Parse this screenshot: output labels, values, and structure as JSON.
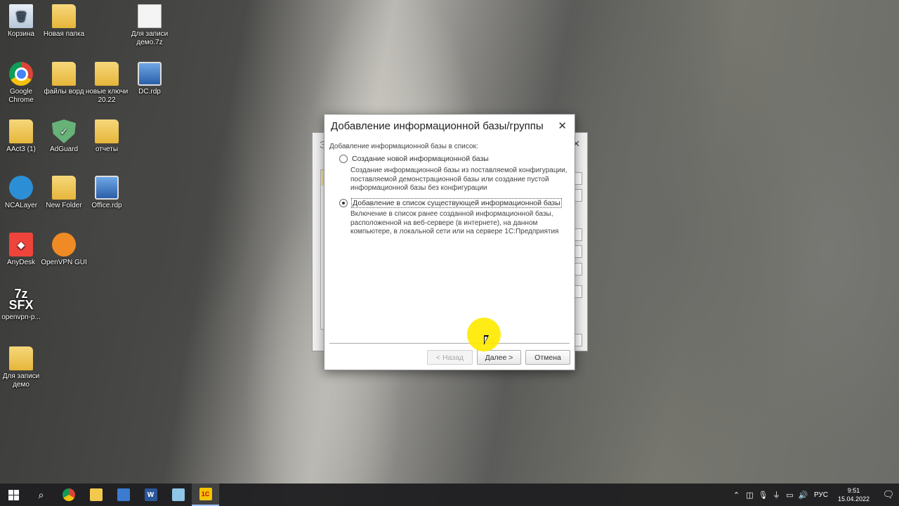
{
  "desktop": {
    "icons": [
      {
        "label": "Корзина",
        "icon": "recycle-bin-icon"
      },
      {
        "label": "Новая папка",
        "icon": "folder-icon"
      },
      {
        "label": "Для записи демо.7z",
        "icon": "file-icon"
      },
      {
        "label": "Google Chrome",
        "icon": "chrome-icon"
      },
      {
        "label": "файлы ворд",
        "icon": "folder-icon"
      },
      {
        "label": "новые ключи 20.22",
        "icon": "folder-icon"
      },
      {
        "label": "DC.rdp",
        "icon": "rdp-icon"
      },
      {
        "label": "AAct3 (1)",
        "icon": "folder-icon"
      },
      {
        "label": "AdGuard",
        "icon": "adguard-icon"
      },
      {
        "label": "отчеты",
        "icon": "folder-icon"
      },
      {
        "label": "NCALayer",
        "icon": "ncalayer-icon"
      },
      {
        "label": "New Folder",
        "icon": "folder-icon"
      },
      {
        "label": "Office.rdp",
        "icon": "rdp-icon"
      },
      {
        "label": "AnyDesk",
        "icon": "anydesk-icon"
      },
      {
        "label": "OpenVPN GUI",
        "icon": "openvpn-icon"
      },
      {
        "label": "openvpn-p...",
        "icon": "sfx-icon",
        "glyph": "7z SFX"
      },
      {
        "label": "Для записи демо",
        "icon": "folder-icon"
      }
    ]
  },
  "background_window": {
    "title_fragment": "З"
  },
  "dialog": {
    "title": "Добавление информационной базы/группы",
    "close_glyph": "✕",
    "section_label": "Добавление информационной базы в список:",
    "options": [
      {
        "label": "Создание новой информационной базы",
        "checked": false,
        "description": "Создание информационной базы из поставляемой конфигурации, поставляемой демонстрационной базы или создание пустой информационной базы без конфигурации"
      },
      {
        "label": "Добавление в список существующей информационной базы",
        "checked": true,
        "description": "Включение в список ранее созданной информационной базы, расположенной на веб-сервере (в интернете), на данном компьютере,  в локальной сети или на сервере 1С:Предприятия"
      }
    ],
    "buttons": {
      "back": "< Назад",
      "next": "Далее >",
      "cancel": "Отмена"
    }
  },
  "taskbar": {
    "apps": [
      {
        "name": "windows-start",
        "icon": "windows-logo-icon"
      },
      {
        "name": "search",
        "icon": "search-icon"
      },
      {
        "name": "chrome",
        "icon": "chrome-icon"
      },
      {
        "name": "file-explorer",
        "icon": "folder-icon"
      },
      {
        "name": "remote-desktop",
        "icon": "rdp-icon"
      },
      {
        "name": "word",
        "icon": "word-icon",
        "glyph": "W"
      },
      {
        "name": "notepad",
        "icon": "notepad-icon"
      },
      {
        "name": "1c-enterprise",
        "icon": "1c-icon",
        "glyph": "1С",
        "active": true
      }
    ],
    "tray": {
      "language": "РУС",
      "time": "9:51",
      "date": "15.04.2022"
    }
  },
  "colors": {
    "cursor_highlight": "#ffea00",
    "taskbar_bg": "#202022",
    "dialog_bg": "#ffffff",
    "focus_bg": "#fbe9a7"
  }
}
